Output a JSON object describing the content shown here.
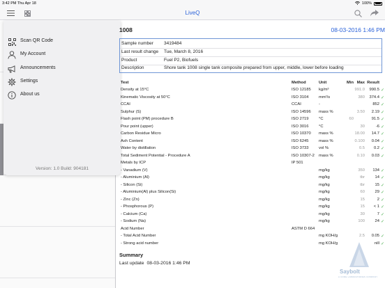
{
  "status_bar": {
    "time_date": "3:42 PM  Thu Apr 18",
    "battery": "100%"
  },
  "nav": {
    "title": "LiveQ"
  },
  "menu": {
    "items": [
      {
        "label": "Scan QR Code",
        "icon": "qr-code-icon"
      },
      {
        "label": "My Account",
        "icon": "person-icon"
      },
      {
        "label": "Announcements",
        "icon": "megaphone-icon"
      },
      {
        "label": "Settings",
        "icon": "gear-icon"
      },
      {
        "label": "About us",
        "icon": "info-icon"
      }
    ],
    "version": "Version: 1.0  Build: 904181"
  },
  "detail": {
    "header": "1008",
    "date": "08-03-2016  1:46 PM",
    "info": [
      {
        "key": "Sample number",
        "value": "3419484"
      },
      {
        "key": "Last result change",
        "value": "Tue, March 8, 2016"
      },
      {
        "key": "Product",
        "value": "Fuel P2, Biofuels"
      },
      {
        "key": "Description",
        "value": "Shore tank 1008  single tank composite prepared from upper, middle, lower before loading"
      }
    ],
    "table": {
      "headers": {
        "test": "Test",
        "method": "Method",
        "unit": "Unit",
        "min": "Min",
        "max": "Max",
        "result": "Result"
      },
      "rows": [
        {
          "test": "Density at 15°C",
          "method": "ISO 12185",
          "unit": "kg/m³",
          "min": "",
          "max": "991.0",
          "result": "990.5",
          "ok": "✓"
        },
        {
          "test": "Kinematic Viscosity at 50°C",
          "method": "ISO 3104",
          "unit": "mm²/s",
          "min": "",
          "max": "380",
          "result": "374.4",
          "ok": "✓"
        },
        {
          "test": "CCAI",
          "method": "CCAI",
          "unit": "-",
          "min": "",
          "max": "",
          "result": "852",
          "ok": "✓"
        },
        {
          "test": "Sulphur (S)",
          "method": "ISO 14596",
          "unit": "mass %",
          "min": "",
          "max": "3.50",
          "result": "2.19",
          "ok": "✓"
        },
        {
          "test": "Flash point (PM) procedure B",
          "method": "ISO 2719",
          "unit": "°C",
          "min": "60",
          "max": "",
          "result": "91.5",
          "ok": "✓"
        },
        {
          "test": "Pour point (upper)",
          "method": "ISO 3016",
          "unit": "°C",
          "min": "",
          "max": "30",
          "result": "-6",
          "ok": "✓"
        },
        {
          "test": "Carbon Residue Micro",
          "method": "ISO 10370",
          "unit": "mass %",
          "min": "",
          "max": "18.00",
          "result": "14.7",
          "ok": "✓"
        },
        {
          "test": "Ash Content",
          "method": "ISO 6245",
          "unit": "mass %",
          "min": "",
          "max": "0.100",
          "result": "0.04",
          "ok": "✓"
        },
        {
          "test": "Water by distillation",
          "method": "ISO 3733",
          "unit": "vol %",
          "min": "",
          "max": "0.5",
          "result": "0.2",
          "ok": "✓"
        },
        {
          "test": "Total Sediment Potential - Procedure A",
          "method": "ISO 10307-2",
          "unit": "mass %",
          "min": "",
          "max": "0.10",
          "result": "0.03",
          "ok": "✓"
        },
        {
          "test": "Metals by ICP",
          "method": "IP 501",
          "unit": "",
          "min": "",
          "max": "",
          "result": "",
          "ok": ""
        },
        {
          "test": "  - Vanadium (V)",
          "method": "",
          "unit": "mg/kg",
          "min": "",
          "max": "350",
          "result": "134",
          "ok": "✓"
        },
        {
          "test": "  - Aluminium (Al)",
          "method": "",
          "unit": "mg/kg",
          "min": "",
          "max": "tbr",
          "result": "14",
          "ok": "✓"
        },
        {
          "test": "  - Silicon (Si)",
          "method": "",
          "unit": "mg/kg",
          "min": "",
          "max": "tbr",
          "result": "15",
          "ok": "✓"
        },
        {
          "test": "  - Aluminium(Al) plus Silicon(Si)",
          "method": "",
          "unit": "mg/kg",
          "min": "",
          "max": "60",
          "result": "29",
          "ok": "✓"
        },
        {
          "test": "  - Zinc (Zn)",
          "method": "",
          "unit": "mg/kg",
          "min": "",
          "max": "15",
          "result": "2",
          "ok": "✓"
        },
        {
          "test": "  - Phosphorous (P)",
          "method": "",
          "unit": "mg/kg",
          "min": "",
          "max": "15",
          "result": "< 1",
          "ok": "✓"
        },
        {
          "test": "  - Calcium (Ca)",
          "method": "",
          "unit": "mg/kg",
          "min": "",
          "max": "30",
          "result": "7",
          "ok": "✓"
        },
        {
          "test": "  - Sodium (Na)",
          "method": "",
          "unit": "mg/kg",
          "min": "",
          "max": "100",
          "result": "24",
          "ok": "✓"
        },
        {
          "test": "Acid Number",
          "method": "ASTM D 664",
          "unit": "",
          "min": "",
          "max": "",
          "result": "",
          "ok": ""
        },
        {
          "test": "  - Total Acid Number",
          "method": "",
          "unit": "mg KOH/g",
          "min": "",
          "max": "2.5",
          "result": "0.05",
          "ok": "✓"
        },
        {
          "test": "  - Strong acid number",
          "method": "",
          "unit": "mg KOH/g",
          "min": "",
          "max": "",
          "result": "nill",
          "ok": "✓"
        }
      ]
    },
    "summary_title": "Summary",
    "last_update_label": "Last update",
    "last_update_value": "08-03-2016  1:46 PM",
    "logo_text": "Saybolt",
    "logo_sub": "A CORE LABORATORIES COMPANY"
  },
  "colors": {
    "accent": "#2b62d9",
    "ok": "#4caf50"
  }
}
